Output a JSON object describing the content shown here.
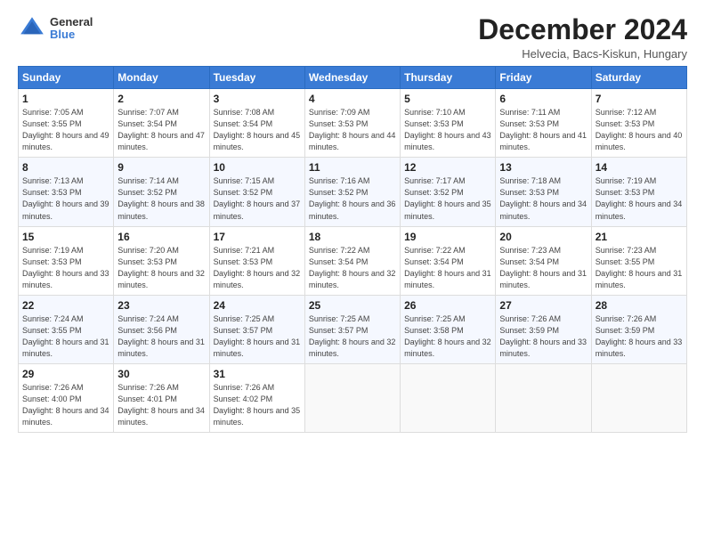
{
  "header": {
    "logo_general": "General",
    "logo_blue": "Blue",
    "title": "December 2024",
    "subtitle": "Helvecia, Bacs-Kiskun, Hungary"
  },
  "columns": [
    "Sunday",
    "Monday",
    "Tuesday",
    "Wednesday",
    "Thursday",
    "Friday",
    "Saturday"
  ],
  "weeks": [
    [
      {
        "day": "1",
        "sunrise": "Sunrise: 7:05 AM",
        "sunset": "Sunset: 3:55 PM",
        "daylight": "Daylight: 8 hours and 49 minutes."
      },
      {
        "day": "2",
        "sunrise": "Sunrise: 7:07 AM",
        "sunset": "Sunset: 3:54 PM",
        "daylight": "Daylight: 8 hours and 47 minutes."
      },
      {
        "day": "3",
        "sunrise": "Sunrise: 7:08 AM",
        "sunset": "Sunset: 3:54 PM",
        "daylight": "Daylight: 8 hours and 45 minutes."
      },
      {
        "day": "4",
        "sunrise": "Sunrise: 7:09 AM",
        "sunset": "Sunset: 3:53 PM",
        "daylight": "Daylight: 8 hours and 44 minutes."
      },
      {
        "day": "5",
        "sunrise": "Sunrise: 7:10 AM",
        "sunset": "Sunset: 3:53 PM",
        "daylight": "Daylight: 8 hours and 43 minutes."
      },
      {
        "day": "6",
        "sunrise": "Sunrise: 7:11 AM",
        "sunset": "Sunset: 3:53 PM",
        "daylight": "Daylight: 8 hours and 41 minutes."
      },
      {
        "day": "7",
        "sunrise": "Sunrise: 7:12 AM",
        "sunset": "Sunset: 3:53 PM",
        "daylight": "Daylight: 8 hours and 40 minutes."
      }
    ],
    [
      {
        "day": "8",
        "sunrise": "Sunrise: 7:13 AM",
        "sunset": "Sunset: 3:53 PM",
        "daylight": "Daylight: 8 hours and 39 minutes."
      },
      {
        "day": "9",
        "sunrise": "Sunrise: 7:14 AM",
        "sunset": "Sunset: 3:52 PM",
        "daylight": "Daylight: 8 hours and 38 minutes."
      },
      {
        "day": "10",
        "sunrise": "Sunrise: 7:15 AM",
        "sunset": "Sunset: 3:52 PM",
        "daylight": "Daylight: 8 hours and 37 minutes."
      },
      {
        "day": "11",
        "sunrise": "Sunrise: 7:16 AM",
        "sunset": "Sunset: 3:52 PM",
        "daylight": "Daylight: 8 hours and 36 minutes."
      },
      {
        "day": "12",
        "sunrise": "Sunrise: 7:17 AM",
        "sunset": "Sunset: 3:52 PM",
        "daylight": "Daylight: 8 hours and 35 minutes."
      },
      {
        "day": "13",
        "sunrise": "Sunrise: 7:18 AM",
        "sunset": "Sunset: 3:53 PM",
        "daylight": "Daylight: 8 hours and 34 minutes."
      },
      {
        "day": "14",
        "sunrise": "Sunrise: 7:19 AM",
        "sunset": "Sunset: 3:53 PM",
        "daylight": "Daylight: 8 hours and 34 minutes."
      }
    ],
    [
      {
        "day": "15",
        "sunrise": "Sunrise: 7:19 AM",
        "sunset": "Sunset: 3:53 PM",
        "daylight": "Daylight: 8 hours and 33 minutes."
      },
      {
        "day": "16",
        "sunrise": "Sunrise: 7:20 AM",
        "sunset": "Sunset: 3:53 PM",
        "daylight": "Daylight: 8 hours and 32 minutes."
      },
      {
        "day": "17",
        "sunrise": "Sunrise: 7:21 AM",
        "sunset": "Sunset: 3:53 PM",
        "daylight": "Daylight: 8 hours and 32 minutes."
      },
      {
        "day": "18",
        "sunrise": "Sunrise: 7:22 AM",
        "sunset": "Sunset: 3:54 PM",
        "daylight": "Daylight: 8 hours and 32 minutes."
      },
      {
        "day": "19",
        "sunrise": "Sunrise: 7:22 AM",
        "sunset": "Sunset: 3:54 PM",
        "daylight": "Daylight: 8 hours and 31 minutes."
      },
      {
        "day": "20",
        "sunrise": "Sunrise: 7:23 AM",
        "sunset": "Sunset: 3:54 PM",
        "daylight": "Daylight: 8 hours and 31 minutes."
      },
      {
        "day": "21",
        "sunrise": "Sunrise: 7:23 AM",
        "sunset": "Sunset: 3:55 PM",
        "daylight": "Daylight: 8 hours and 31 minutes."
      }
    ],
    [
      {
        "day": "22",
        "sunrise": "Sunrise: 7:24 AM",
        "sunset": "Sunset: 3:55 PM",
        "daylight": "Daylight: 8 hours and 31 minutes."
      },
      {
        "day": "23",
        "sunrise": "Sunrise: 7:24 AM",
        "sunset": "Sunset: 3:56 PM",
        "daylight": "Daylight: 8 hours and 31 minutes."
      },
      {
        "day": "24",
        "sunrise": "Sunrise: 7:25 AM",
        "sunset": "Sunset: 3:57 PM",
        "daylight": "Daylight: 8 hours and 31 minutes."
      },
      {
        "day": "25",
        "sunrise": "Sunrise: 7:25 AM",
        "sunset": "Sunset: 3:57 PM",
        "daylight": "Daylight: 8 hours and 32 minutes."
      },
      {
        "day": "26",
        "sunrise": "Sunrise: 7:25 AM",
        "sunset": "Sunset: 3:58 PM",
        "daylight": "Daylight: 8 hours and 32 minutes."
      },
      {
        "day": "27",
        "sunrise": "Sunrise: 7:26 AM",
        "sunset": "Sunset: 3:59 PM",
        "daylight": "Daylight: 8 hours and 33 minutes."
      },
      {
        "day": "28",
        "sunrise": "Sunrise: 7:26 AM",
        "sunset": "Sunset: 3:59 PM",
        "daylight": "Daylight: 8 hours and 33 minutes."
      }
    ],
    [
      {
        "day": "29",
        "sunrise": "Sunrise: 7:26 AM",
        "sunset": "Sunset: 4:00 PM",
        "daylight": "Daylight: 8 hours and 34 minutes."
      },
      {
        "day": "30",
        "sunrise": "Sunrise: 7:26 AM",
        "sunset": "Sunset: 4:01 PM",
        "daylight": "Daylight: 8 hours and 34 minutes."
      },
      {
        "day": "31",
        "sunrise": "Sunrise: 7:26 AM",
        "sunset": "Sunset: 4:02 PM",
        "daylight": "Daylight: 8 hours and 35 minutes."
      },
      null,
      null,
      null,
      null
    ]
  ]
}
